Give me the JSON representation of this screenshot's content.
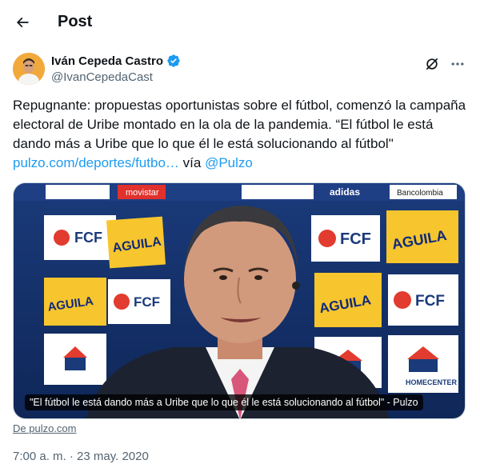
{
  "header": {
    "title": "Post"
  },
  "author": {
    "name": "Iván Cepeda Castro",
    "handle": "@IvanCepedaCast",
    "verified": true,
    "verified_color": "#1d9bf0"
  },
  "tweet": {
    "text": "Repugnante: propuestas oportunistas sobre el fútbol, comenzó la campaña electoral de Uribe montado en la ola de la pandemia. “El fútbol le está dando más a Uribe que lo que él le está solucionando al fútbol\"",
    "link_text": "pulzo.com/deportes/futbo…",
    "via_text": "vía",
    "mention": "@Pulzo",
    "link_color": "#1d9bf0"
  },
  "media": {
    "caption": "\"El fútbol le está dando más a Uribe que lo que él le está solucionando al fútbol\" - Pulzo",
    "source": "De pulzo.com",
    "backdrop_texts": [
      "FCF",
      "AGUILA",
      "adidas",
      "Bancolombia",
      "HOMECENTER",
      "movistar"
    ]
  },
  "meta": {
    "timestamp": "7:00 a. m. · 23 may. 2020"
  },
  "icons": {
    "back": "arrow-left-icon",
    "verified": "verified-badge-icon",
    "grok": "grok-icon",
    "more": "more-horizontal-icon"
  }
}
